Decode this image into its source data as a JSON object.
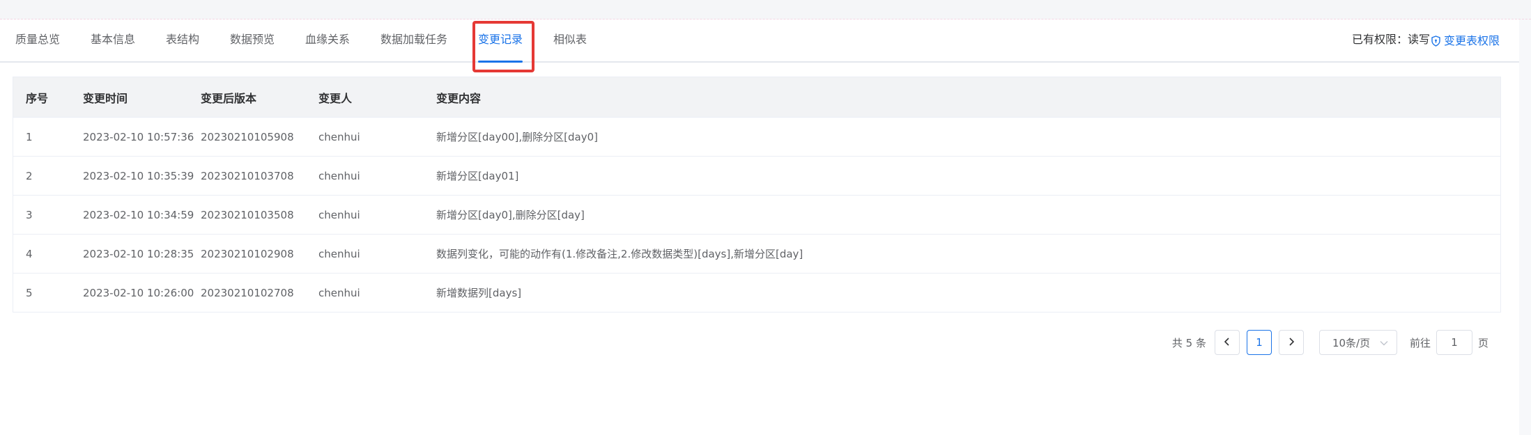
{
  "tabs": [
    {
      "label": "质量总览",
      "active": false
    },
    {
      "label": "基本信息",
      "active": false
    },
    {
      "label": "表结构",
      "active": false
    },
    {
      "label": "数据预览",
      "active": false
    },
    {
      "label": "血缘关系",
      "active": false
    },
    {
      "label": "数据加载任务",
      "active": false
    },
    {
      "label": "变更记录",
      "active": true
    },
    {
      "label": "相似表",
      "active": false
    }
  ],
  "permission": {
    "current": "已有权限：读写",
    "change_link": "变更表权限"
  },
  "table": {
    "headers": [
      "序号",
      "变更时间",
      "变更后版本",
      "变更人",
      "变更内容"
    ],
    "rows": [
      [
        "1",
        "2023-02-10 10:57:36",
        "20230210105908",
        "chenhui",
        "新增分区[day00],删除分区[day0]"
      ],
      [
        "2",
        "2023-02-10 10:35:39",
        "20230210103708",
        "chenhui",
        "新增分区[day01]"
      ],
      [
        "3",
        "2023-02-10 10:34:59",
        "20230210103508",
        "chenhui",
        "新增分区[day0],删除分区[day]"
      ],
      [
        "4",
        "2023-02-10 10:28:35",
        "20230210102908",
        "chenhui",
        "数据列变化，可能的动作有(1.修改备注,2.修改数据类型)[days],新增分区[day]"
      ],
      [
        "5",
        "2023-02-10 10:26:00",
        "20230210102708",
        "chenhui",
        "新增数据列[days]"
      ]
    ]
  },
  "pagination": {
    "total": "共 5 条",
    "current_page": "1",
    "page_size": "10条/页",
    "goto_label": "前往",
    "goto_value": "1",
    "page_unit": "页"
  },
  "colors": {
    "accent": "#1a73e8",
    "highlight": "#e53935"
  }
}
